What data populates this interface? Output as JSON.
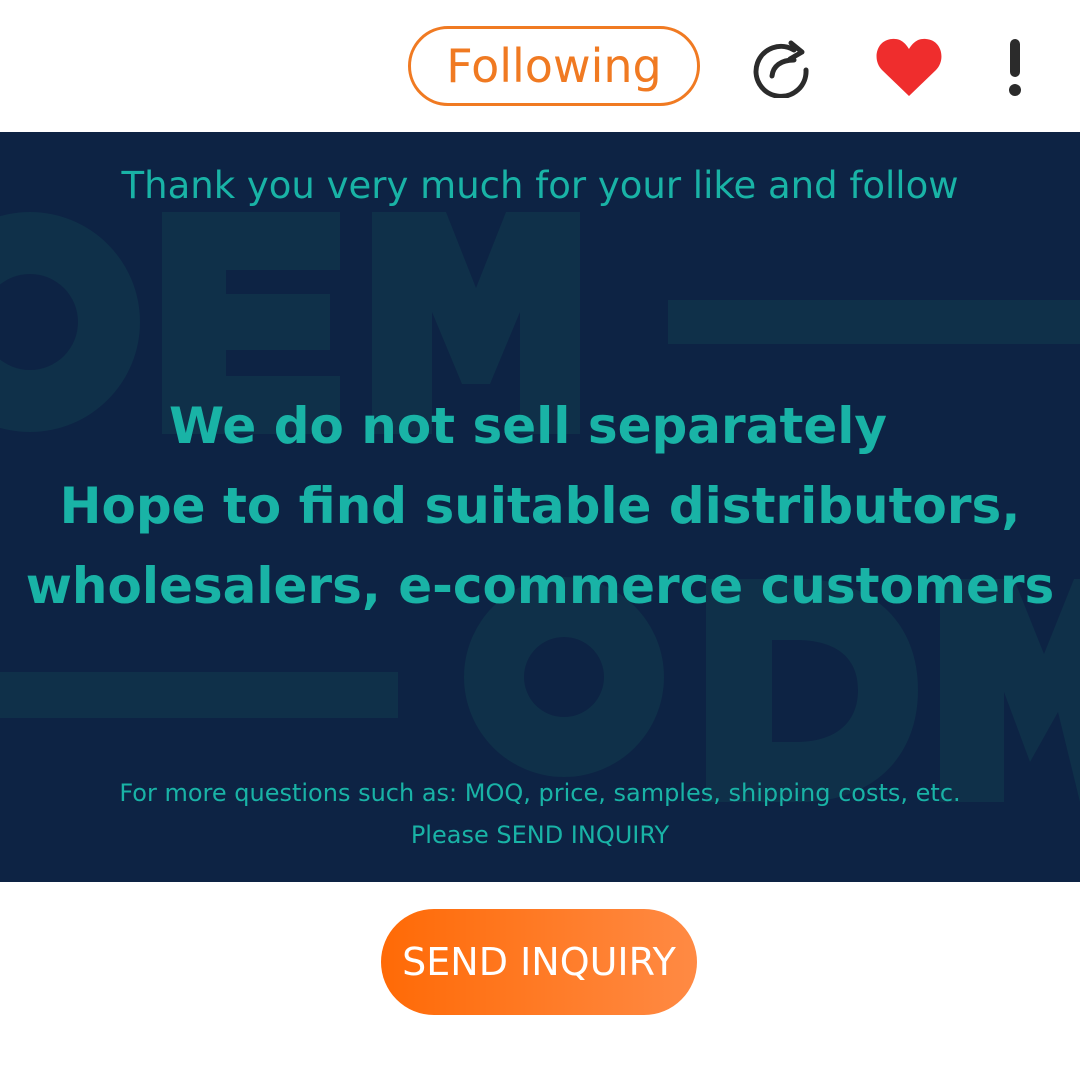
{
  "toolbar": {
    "follow_label": "Following",
    "share_icon": "share-refresh-icon",
    "like_icon": "heart-icon",
    "more_icon": "exclamation-more-icon",
    "accent_color": "#f07a22",
    "heart_color": "#ef2d2d"
  },
  "banner": {
    "background_color": "#0d2344",
    "text_color": "#19b3a6",
    "thanks": "Thank you very much for your like and follow",
    "headline_lines": [
      "We do not sell separately",
      "Hope to find suitable distributors,",
      "wholesalers, e-commerce customers"
    ],
    "footnote_lines": [
      "For more questions such as: MOQ, price, samples, shipping costs, etc.",
      "Please SEND INQUIRY"
    ],
    "watermark_words": [
      "OEM",
      "ODM"
    ]
  },
  "inquiry": {
    "label": "SEND INQUIRY"
  }
}
